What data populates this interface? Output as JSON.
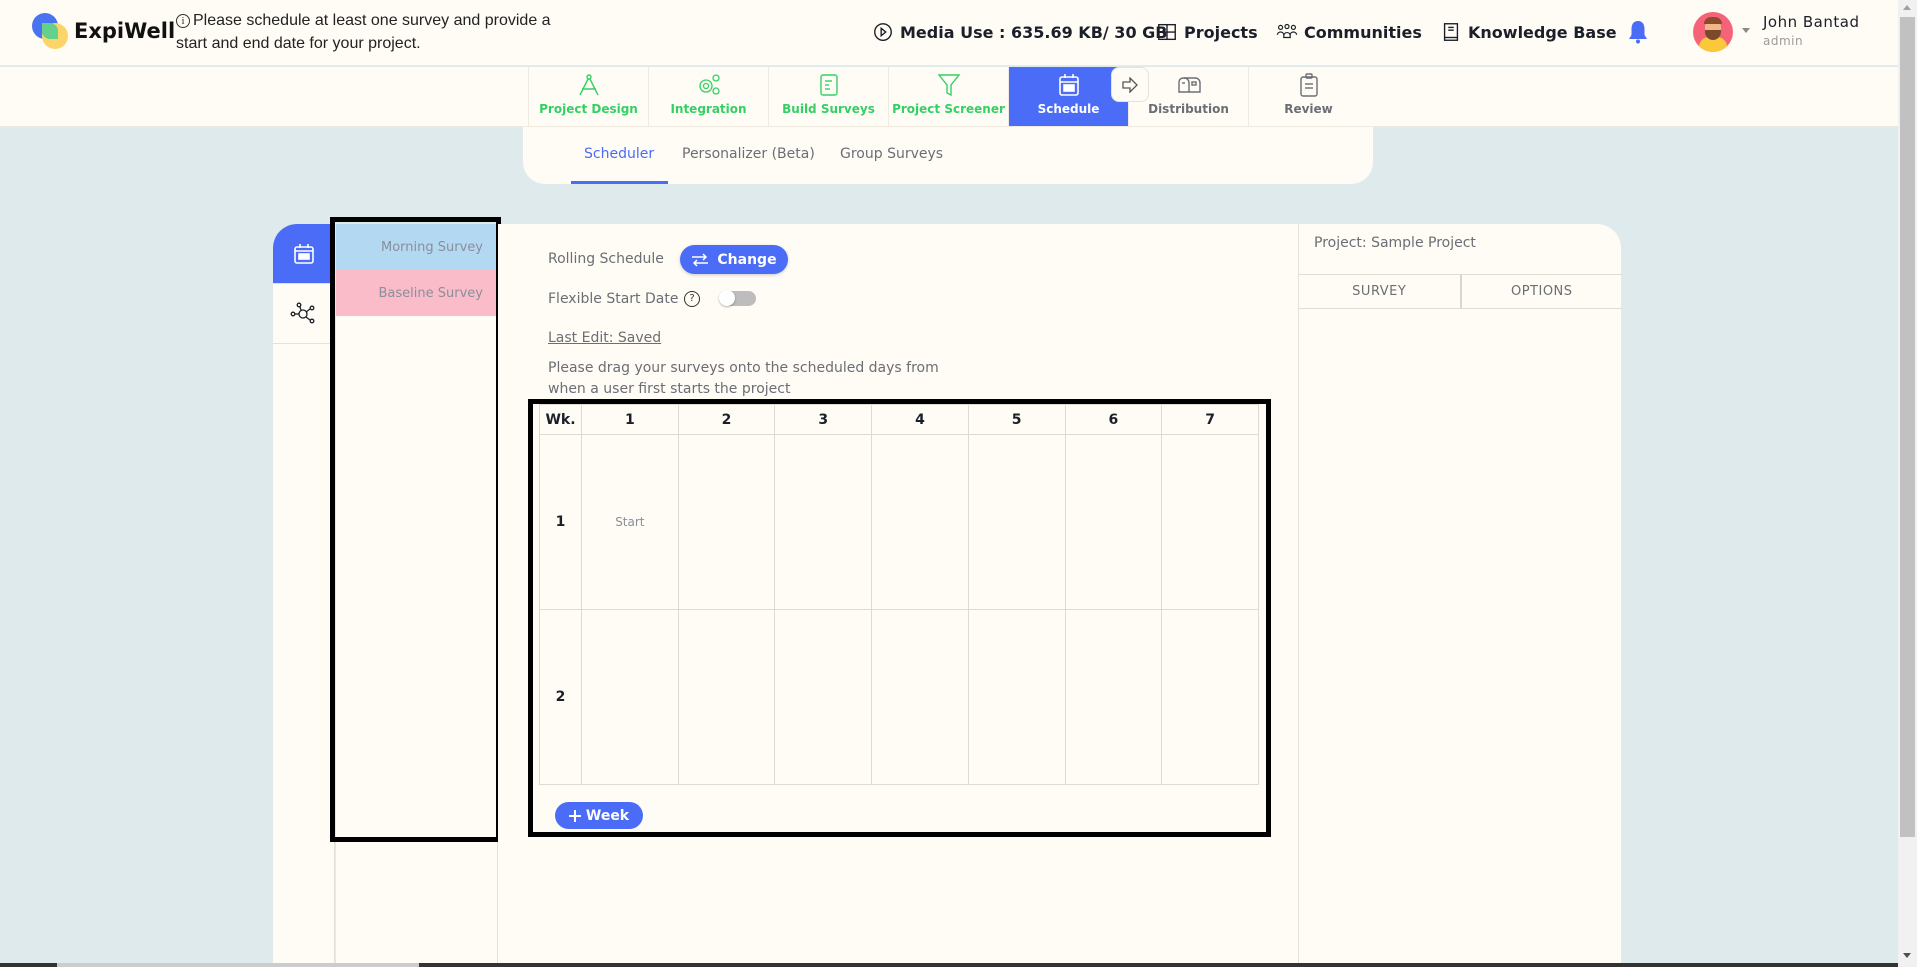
{
  "header": {
    "brand": "ExpiWell",
    "notice": "Please schedule at least one survey and provide a start and end date for your project.",
    "media_use": "Media Use : 635.69 KB/ 30 GB",
    "nav": [
      {
        "label": "Projects",
        "icon": "grid-icon"
      },
      {
        "label": "Communities",
        "icon": "people-icon"
      },
      {
        "label": "Knowledge Base",
        "icon": "book-icon"
      }
    ],
    "user": {
      "name": "John Bantad",
      "role": "admin"
    }
  },
  "steps": [
    {
      "label": "Project Design",
      "icon": "compass-icon",
      "state": "done"
    },
    {
      "label": "Integration",
      "icon": "gears-icon",
      "state": "done"
    },
    {
      "label": "Build Surveys",
      "icon": "document-icon",
      "state": "done"
    },
    {
      "label": "Project Screener",
      "icon": "filter-icon",
      "state": "done"
    },
    {
      "label": "Schedule",
      "icon": "calendar-icon",
      "state": "active"
    },
    {
      "label": "Distribution",
      "icon": "mailbox-icon",
      "state": "todo"
    },
    {
      "label": "Review",
      "icon": "clipboard-icon",
      "state": "todo"
    }
  ],
  "subtabs": [
    {
      "label": "Scheduler",
      "active": true
    },
    {
      "label": "Personalizer (Beta)",
      "active": false
    },
    {
      "label": "Group Surveys",
      "active": false
    }
  ],
  "surveys": [
    {
      "label": "Morning Survey",
      "color": "#b3d8f2"
    },
    {
      "label": "Baseline Survey",
      "color": "#fbbcca"
    }
  ],
  "scheduler": {
    "rolling_label": "Rolling Schedule",
    "change_label": "Change",
    "flexible_label": "Flexible Start Date",
    "flexible_enabled": false,
    "help_glyph": "?",
    "last_edit": "Last Edit: Saved",
    "instructions": "Please drag your surveys onto the scheduled days from when a user first starts the project",
    "grid": {
      "week_header": "Wk.",
      "days": [
        "1",
        "2",
        "3",
        "4",
        "5",
        "6",
        "7"
      ],
      "weeks": [
        {
          "label": "1",
          "cells": [
            "Start",
            "",
            "",
            "",
            "",
            "",
            ""
          ]
        },
        {
          "label": "2",
          "cells": [
            "",
            "",
            "",
            "",
            "",
            "",
            ""
          ]
        }
      ]
    },
    "add_week_label": "Week"
  },
  "right_panel": {
    "project_title": "Project: Sample Project",
    "tabs": [
      "SURVEY",
      "OPTIONS"
    ]
  },
  "colors": {
    "accent": "#4a6cf7",
    "done_green": "#34d065",
    "background": "#deeaec",
    "panel": "#fffcf5"
  }
}
